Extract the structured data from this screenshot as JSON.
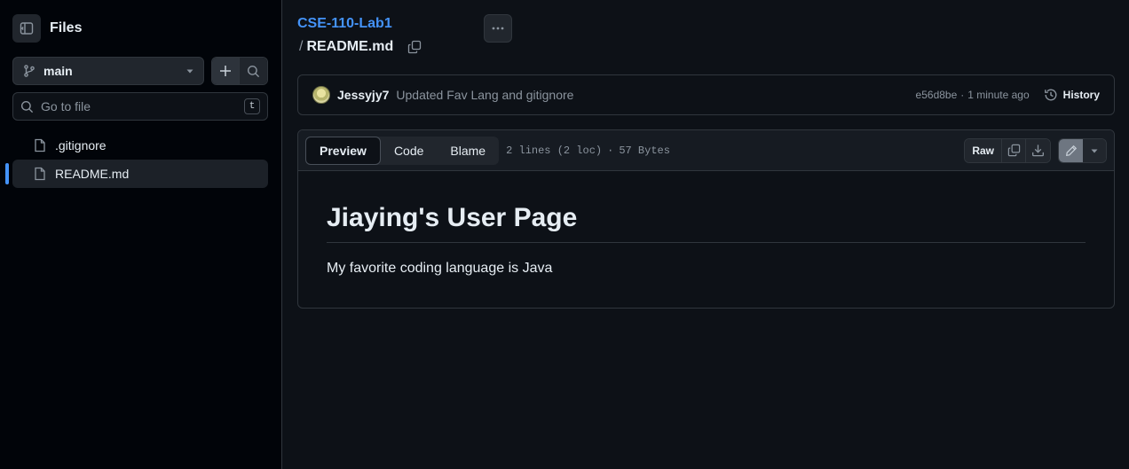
{
  "sidebar": {
    "title": "Files",
    "branch": "main",
    "search": {
      "placeholder": "Go to file",
      "shortcut": "t"
    },
    "files": [
      {
        "name": ".gitignore",
        "active": false
      },
      {
        "name": "README.md",
        "active": true
      }
    ]
  },
  "breadcrumb": {
    "repo": "CSE-110-Lab1",
    "separator": "/",
    "file": "README.md"
  },
  "commit": {
    "author": "Jessyjy7",
    "message": "Updated Fav Lang and gitignore",
    "sha": "e56d8be",
    "dot": "·",
    "time": "1 minute ago",
    "history_label": "History"
  },
  "file_view": {
    "tabs": [
      "Preview",
      "Code",
      "Blame"
    ],
    "selected_tab": "Preview",
    "lines_info": "2 lines (2 loc)",
    "dot": "·",
    "size_info": "57 Bytes",
    "raw_label": "Raw"
  },
  "readme": {
    "heading": "Jiaying's User Page",
    "paragraph": "My favorite coding language is Java"
  },
  "colors": {
    "background": "#0d1117",
    "sidebar_bg": "#010409",
    "accent": "#4493f8",
    "border": "#30363d"
  }
}
